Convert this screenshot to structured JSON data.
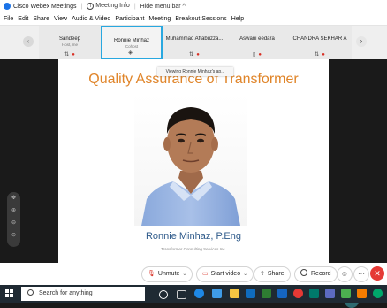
{
  "titlebar": {
    "app_title": "Cisco Webex Meetings",
    "meeting_info": "Meeting Info",
    "hide_menu": "Hide menu bar",
    "hide_menu_arrow": "^"
  },
  "menu": [
    "File",
    "Edit",
    "Share",
    "View",
    "Audio & Video",
    "Participant",
    "Meeting",
    "Breakout Sessions",
    "Help"
  ],
  "participants": [
    {
      "name": "Sandeep",
      "role": "Host, me"
    },
    {
      "name": "Ronnie Minhaz",
      "role": "Cohost"
    },
    {
      "name": "Muhammad Aftabuzza...",
      "role": ""
    },
    {
      "name": "Aswani eedara",
      "role": ""
    },
    {
      "name": "CHANDRA SEKHAR A",
      "role": ""
    }
  ],
  "viewing_banner": "Viewing Ronnie Minhaz's ap...",
  "slide": {
    "title": "Quality Assurance of Transformer",
    "name": "Ronnie Minhaz, P.Eng",
    "company": "Transformer Consulting Services Inc."
  },
  "controls": {
    "unmute": "Unmute",
    "start_video": "Start video",
    "share": "Share",
    "record": "Record",
    "more": "···"
  },
  "taskbar": {
    "search_placeholder": "Search for anything"
  },
  "colors": {
    "accent": "#29a8e0",
    "slide_title": "#e0852a",
    "slide_name": "#2e5a8a",
    "muted_red": "#d93025",
    "leave_red": "#e53935"
  }
}
